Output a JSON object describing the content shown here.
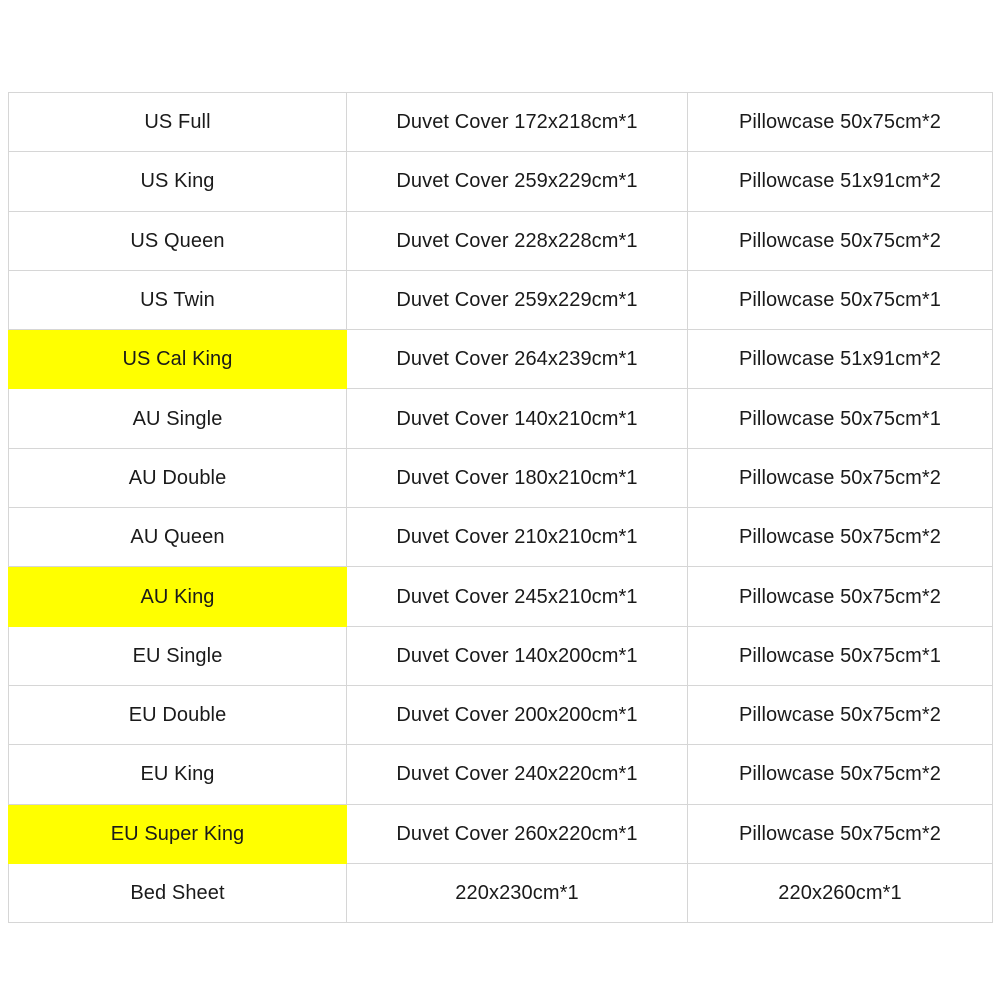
{
  "table": {
    "highlight_color": "#FFFF00",
    "border_color": "#d6d6d6",
    "text_color": "#1a1a1a",
    "rows": [
      {
        "size": "US Full",
        "duvet": "Duvet Cover 172x218cm*1",
        "pillowcase": "Pillowcase 50x75cm*2",
        "highlighted": false
      },
      {
        "size": "US King",
        "duvet": "Duvet Cover 259x229cm*1",
        "pillowcase": "Pillowcase 51x91cm*2",
        "highlighted": false
      },
      {
        "size": "US Queen",
        "duvet": "Duvet Cover 228x228cm*1",
        "pillowcase": "Pillowcase 50x75cm*2",
        "highlighted": false
      },
      {
        "size": "US Twin",
        "duvet": "Duvet Cover 259x229cm*1",
        "pillowcase": "Pillowcase 50x75cm*1",
        "highlighted": false
      },
      {
        "size": "US Cal King",
        "duvet": "Duvet Cover 264x239cm*1",
        "pillowcase": "Pillowcase 51x91cm*2",
        "highlighted": true
      },
      {
        "size": "AU Single",
        "duvet": "Duvet Cover 140x210cm*1",
        "pillowcase": "Pillowcase 50x75cm*1",
        "highlighted": false
      },
      {
        "size": "AU Double",
        "duvet": "Duvet Cover 180x210cm*1",
        "pillowcase": "Pillowcase 50x75cm*2",
        "highlighted": false
      },
      {
        "size": "AU Queen",
        "duvet": "Duvet Cover 210x210cm*1",
        "pillowcase": "Pillowcase 50x75cm*2",
        "highlighted": false
      },
      {
        "size": "AU King",
        "duvet": "Duvet Cover 245x210cm*1",
        "pillowcase": "Pillowcase 50x75cm*2",
        "highlighted": true
      },
      {
        "size": "EU Single",
        "duvet": "Duvet Cover 140x200cm*1",
        "pillowcase": "Pillowcase 50x75cm*1",
        "highlighted": false
      },
      {
        "size": "EU Double",
        "duvet": "Duvet Cover 200x200cm*1",
        "pillowcase": "Pillowcase 50x75cm*2",
        "highlighted": false
      },
      {
        "size": "EU King",
        "duvet": "Duvet Cover 240x220cm*1",
        "pillowcase": "Pillowcase 50x75cm*2",
        "highlighted": false
      },
      {
        "size": "EU Super King",
        "duvet": "Duvet Cover 260x220cm*1",
        "pillowcase": "Pillowcase 50x75cm*2",
        "highlighted": true
      },
      {
        "size": "Bed Sheet",
        "duvet": "220x230cm*1",
        "pillowcase": "220x260cm*1",
        "highlighted": false
      }
    ]
  }
}
